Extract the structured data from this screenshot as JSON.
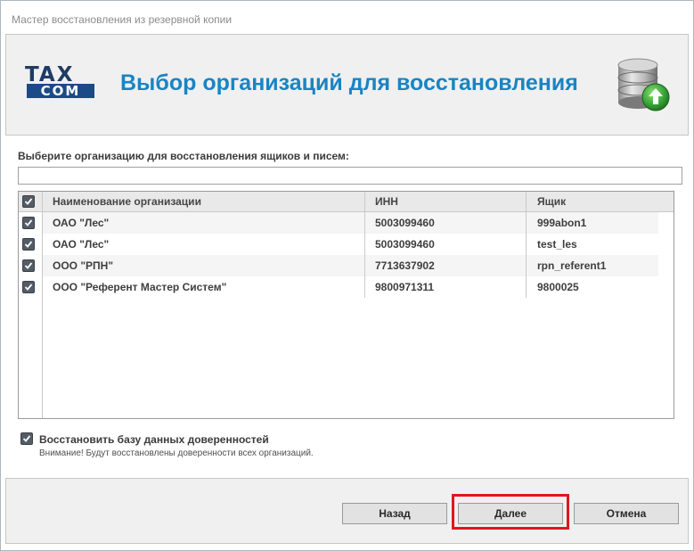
{
  "window": {
    "title": "Мастер восстановления из резервной копии"
  },
  "header": {
    "logo_top": "TAX",
    "logo_bottom": "COM",
    "title": "Выбор организаций для восстановления"
  },
  "content": {
    "prompt": "Выберите организацию для восстановления ящиков и писем:",
    "filter_value": "",
    "columns": {
      "name": "Наименование организации",
      "inn": "ИНН",
      "box": "Ящик"
    },
    "rows": [
      {
        "checked": true,
        "name": "ОАО \"Лес\"",
        "inn": "5003099460",
        "box": "999abon1"
      },
      {
        "checked": true,
        "name": "ОАО \"Лес\"",
        "inn": "5003099460",
        "box": "test_les"
      },
      {
        "checked": true,
        "name": "ООО \"РПН\"",
        "inn": "7713637902",
        "box": "rpn_referent1"
      },
      {
        "checked": true,
        "name": "ООО \"Референт Мастер Систем\"",
        "inn": "9800971311",
        "box": "9800025"
      }
    ],
    "restore_db": {
      "checked": true,
      "label": "Восстановить базу данных доверенностей",
      "note": "Внимание! Будут восстановлены доверенности всех организаций."
    }
  },
  "footer": {
    "back_label": "Назад",
    "next_label": "Далее",
    "cancel_label": "Отмена"
  },
  "colors": {
    "title_blue": "#1a84c3",
    "highlight": "#e0161c",
    "checkbox": "#545c66"
  }
}
